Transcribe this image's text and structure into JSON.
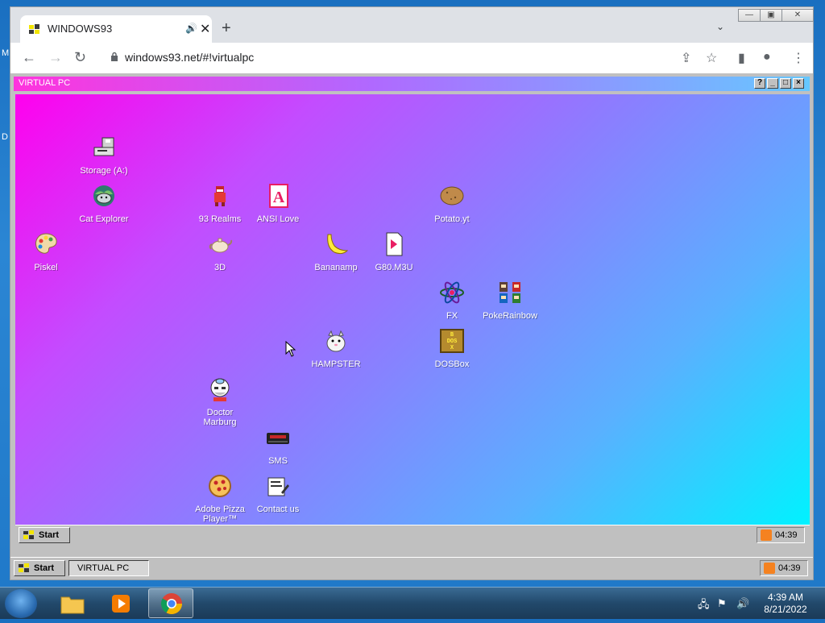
{
  "desktop": {
    "left_text_1": "M",
    "left_text_2": "D"
  },
  "browser": {
    "tab": {
      "title": "WINDOWS93"
    },
    "address": {
      "url": "windows93.net/#!virtualpc"
    }
  },
  "vpc": {
    "title": "VIRTUAL PC",
    "buttons": {
      "help": "?",
      "min": "_",
      "max": "□",
      "close": "×"
    },
    "icons": [
      {
        "label": "Storage (A:)",
        "icon": "floppy-drive-icon"
      },
      {
        "label": "Cat Explorer",
        "icon": "cat-globe-icon"
      },
      {
        "label": "93 Realms",
        "icon": "knight-icon"
      },
      {
        "label": "ANSI Love",
        "icon": "ansi-letter-icon"
      },
      {
        "label": "Potato.yt",
        "icon": "potato-icon"
      },
      {
        "label": "Piskel",
        "icon": "palette-icon"
      },
      {
        "label": "3D",
        "icon": "teapot-icon"
      },
      {
        "label": "Bananamp",
        "icon": "banana-icon"
      },
      {
        "label": "G80.M3U",
        "icon": "playlist-file-icon"
      },
      {
        "label": "FX",
        "icon": "atom-icon"
      },
      {
        "label": "PokeRainbow",
        "icon": "pokemon-trainers-icon"
      },
      {
        "label": "HAMPSTER",
        "icon": "hamster-icon"
      },
      {
        "label": "DOSBox",
        "icon": "dosbox-icon"
      },
      {
        "label": "Doctor Marburg",
        "icon": "doctor-icon"
      },
      {
        "label": "SMS",
        "icon": "game-console-icon"
      },
      {
        "label": "Adobe Pizza Player™",
        "icon": "pizza-icon"
      },
      {
        "label": "Contact us",
        "icon": "contact-form-icon"
      }
    ],
    "inner_taskbar": {
      "start": "Start",
      "clock": "04:39"
    }
  },
  "w93_taskbar": {
    "start": "Start",
    "task": "VIRTUAL PC",
    "clock": "04:39"
  },
  "win7": {
    "time": "4:39 AM",
    "date": "8/21/2022"
  },
  "colors": {
    "accent": "#ff33dd",
    "desktop_start": "#ff00ee",
    "desktop_end": "#00f2ff"
  }
}
